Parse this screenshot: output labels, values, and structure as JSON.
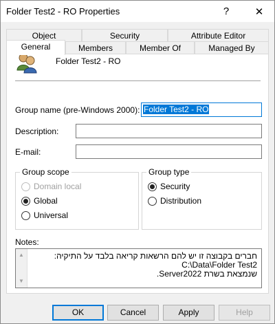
{
  "window": {
    "title": "Folder Test2 - RO Properties",
    "help_glyph": "?",
    "close_glyph": "✕"
  },
  "tabs": {
    "row1": [
      "Object",
      "Security",
      "Attribute Editor"
    ],
    "row2": [
      "General",
      "Members",
      "Member Of",
      "Managed By"
    ],
    "active": "General"
  },
  "general": {
    "group_title": "Folder Test2 - RO",
    "group_name_label": "Group name (pre-Windows 2000):",
    "group_name_value": "Folder Test2 - RO",
    "description_label": "Description:",
    "description_value": "",
    "email_label": "E-mail:",
    "email_value": "",
    "group_scope": {
      "title": "Group scope",
      "options": [
        {
          "label": "Domain local",
          "selected": false,
          "disabled": true
        },
        {
          "label": "Global",
          "selected": true,
          "disabled": false
        },
        {
          "label": "Universal",
          "selected": false,
          "disabled": false
        }
      ]
    },
    "group_type": {
      "title": "Group type",
      "options": [
        {
          "label": "Security",
          "selected": true
        },
        {
          "label": "Distribution",
          "selected": false
        }
      ]
    },
    "notes_label": "Notes:",
    "notes_lines": [
      "חברים בקבוצה זו יש להם הרשאות קריאה בלבד על התיקיה:",
      "C:\\Data\\Folder Test2",
      "שנמצאת בשרת Server2022."
    ]
  },
  "buttons": {
    "ok": "OK",
    "cancel": "Cancel",
    "apply": "Apply",
    "help": "Help"
  }
}
